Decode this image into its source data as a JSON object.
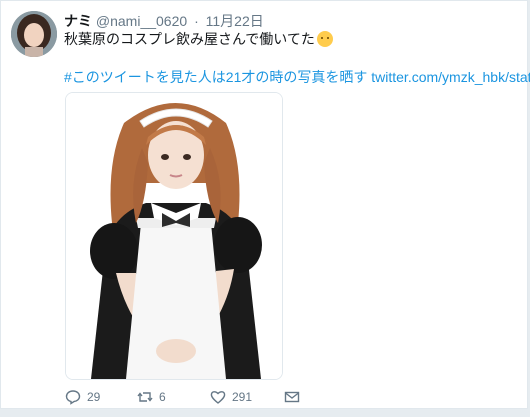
{
  "tweet": {
    "author_name": "ナミ",
    "handle": "@nami__0620",
    "separator": "·",
    "date": "11月22日",
    "text": "秋葉原のコスプレ飲み屋さんで働いてた",
    "hashtag": "#このツイートを見た人は21才の時の写真を晒す",
    "link": "twitter.com/ymzk_hbk/statu…"
  },
  "media": {
    "description_icon": "photo"
  },
  "actions": {
    "reply_count": "29",
    "retweet_count": "6",
    "like_count": "291",
    "reply_icon": "reply-icon",
    "retweet_icon": "retweet-icon",
    "like_icon": "heart-icon",
    "dm_icon": "envelope-icon"
  },
  "colors": {
    "link": "#1b95e0",
    "muted": "#657786",
    "text": "#14171a",
    "background": "#e6ecf0"
  }
}
